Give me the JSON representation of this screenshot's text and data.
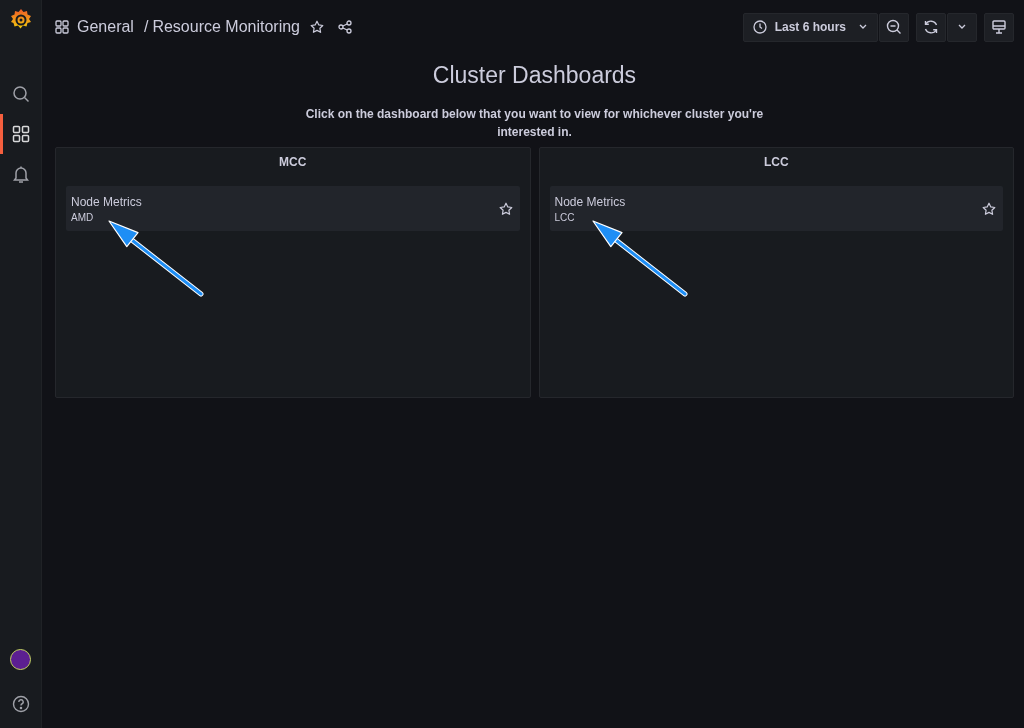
{
  "sidebar": {
    "items": [
      {
        "kind": "search",
        "selected": false
      },
      {
        "kind": "dashboards",
        "selected": true
      },
      {
        "kind": "alerting",
        "selected": false
      }
    ],
    "bottom": [
      {
        "kind": "avatar"
      },
      {
        "kind": "help"
      }
    ]
  },
  "breadcrumb": {
    "folder": "General",
    "separator": "/",
    "title": "Resource Monitoring",
    "starred": false
  },
  "toolbar": {
    "time_range": "Last 6 hours"
  },
  "header": {
    "title": "Cluster Dashboards",
    "description": "Click on the dashboard below that you want to view for whichever cluster you're interested in."
  },
  "panels": [
    {
      "title": "MCC",
      "items": [
        {
          "title": "Node Metrics",
          "folder": "AMD",
          "starred": false,
          "annotated": true
        }
      ]
    },
    {
      "title": "LCC",
      "items": [
        {
          "title": "Node Metrics",
          "folder": "LCC",
          "starred": false,
          "annotated": true
        }
      ]
    }
  ]
}
